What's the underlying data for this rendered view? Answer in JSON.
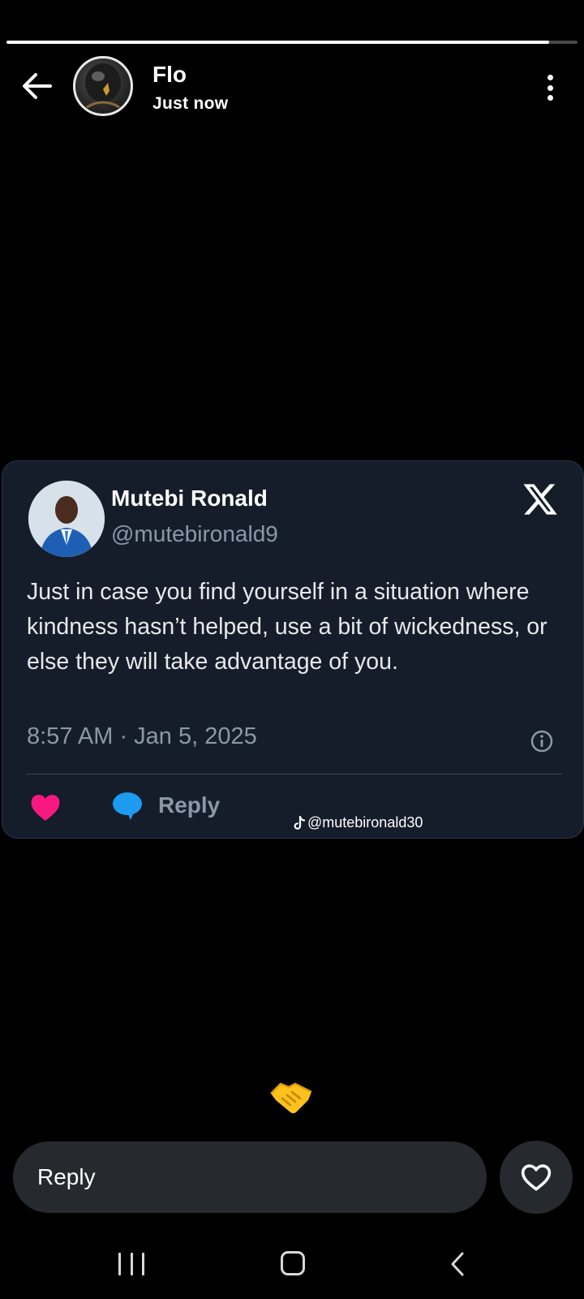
{
  "story": {
    "progress": 0.95,
    "poster_name": "Flo",
    "time": "Just now"
  },
  "tweet": {
    "author_name": "Mutebi Ronald",
    "handle": "@mutebironald9",
    "text": "Just in case you find yourself in a situation where kindness hasn’t helped, use a bit of wickedness, or else they will take advantage of you.",
    "timestamp": "8:57 AM · Jan 5, 2025",
    "reply_label": "Reply",
    "watermark": "@mutebironald30"
  },
  "reaction_emoji": "handshake-emoji",
  "reply_bar": {
    "placeholder": "Reply"
  },
  "colors": {
    "card_bg": "#151d2b",
    "heart": "#f91880",
    "reply_bubble": "#1d9bf0",
    "muted_text": "#8b98a5"
  }
}
